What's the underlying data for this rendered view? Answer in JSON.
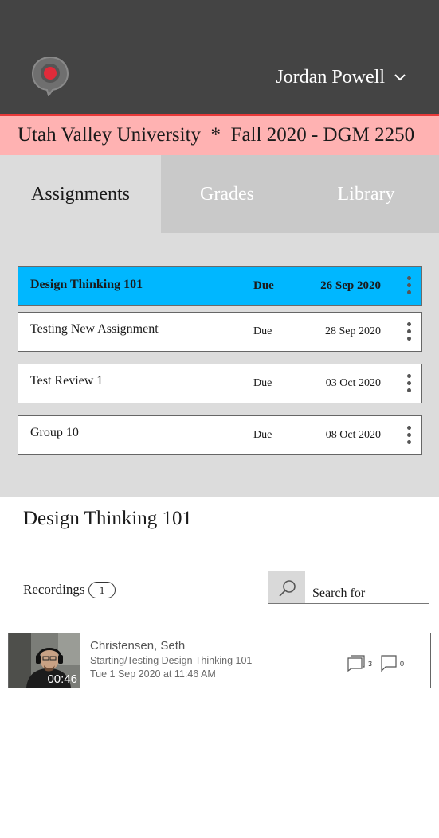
{
  "header": {
    "user_name": "Jordan Powell"
  },
  "course_banner": "Utah Valley University  *  Fall 2020 - DGM 2250",
  "tabs": [
    {
      "label": "Assignments",
      "active": true
    },
    {
      "label": "Grades",
      "active": false
    },
    {
      "label": "Library",
      "active": false
    }
  ],
  "assignments": [
    {
      "name": "Design Thinking 101",
      "due_label": "Due",
      "date": "26 Sep 2020",
      "selected": true
    },
    {
      "name": "Testing New Assignment",
      "due_label": "Due",
      "date": "28 Sep 2020",
      "selected": false
    },
    {
      "name": "Test Review 1",
      "due_label": "Due",
      "date": "03 Oct 2020",
      "selected": false
    },
    {
      "name": "Group 10",
      "due_label": "Due",
      "date": "08 Oct 2020",
      "selected": false
    }
  ],
  "detail": {
    "title": "Design Thinking 101",
    "recordings_label": "Recordings",
    "recordings_count": "1",
    "search_placeholder": "Search for"
  },
  "recordings": [
    {
      "author": "Christensen, Seth",
      "title": "Starting/Testing Design Thinking 101",
      "date": "Tue 1 Sep 2020 at 11:46 AM",
      "duration": "00:46",
      "copies_count": "3",
      "comments_count": "0"
    }
  ],
  "colors": {
    "header_bg": "#444444",
    "banner_bg": "#ffb2b2",
    "banner_accent": "#e83a3a",
    "selected_row": "#00b7ff",
    "logo_red": "#e02b3a"
  },
  "icons": {
    "logo": "speech-bubble-logo-icon",
    "user_menu": "chevron-down-icon",
    "row_menu": "kebab-menu-icon",
    "search": "search-icon",
    "copies": "copies-icon",
    "comments": "comment-icon"
  }
}
